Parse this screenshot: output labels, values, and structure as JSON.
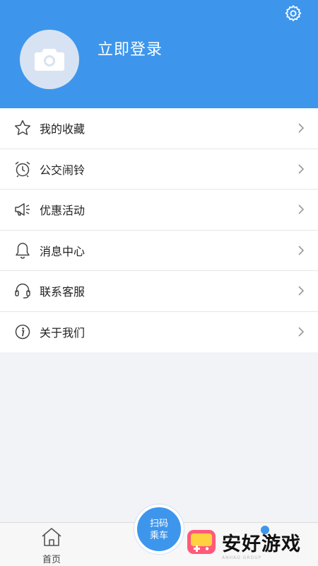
{
  "header": {
    "login_text": "立即登录",
    "accent_color": "#3d96ec"
  },
  "menu": {
    "items": [
      {
        "label": "我的收藏",
        "icon": "star-icon"
      },
      {
        "label": "公交闹铃",
        "icon": "alarm-clock-icon"
      },
      {
        "label": "优惠活动",
        "icon": "megaphone-icon"
      },
      {
        "label": "消息中心",
        "icon": "bell-icon"
      },
      {
        "label": "联系客服",
        "icon": "headset-icon"
      },
      {
        "label": "关于我们",
        "icon": "info-icon"
      }
    ]
  },
  "tabbar": {
    "home_label": "首页",
    "scan_line1": "扫码",
    "scan_line2": "乘车"
  },
  "watermark": {
    "text": "安好游戏",
    "subtext": "ANHAO GROUP"
  }
}
